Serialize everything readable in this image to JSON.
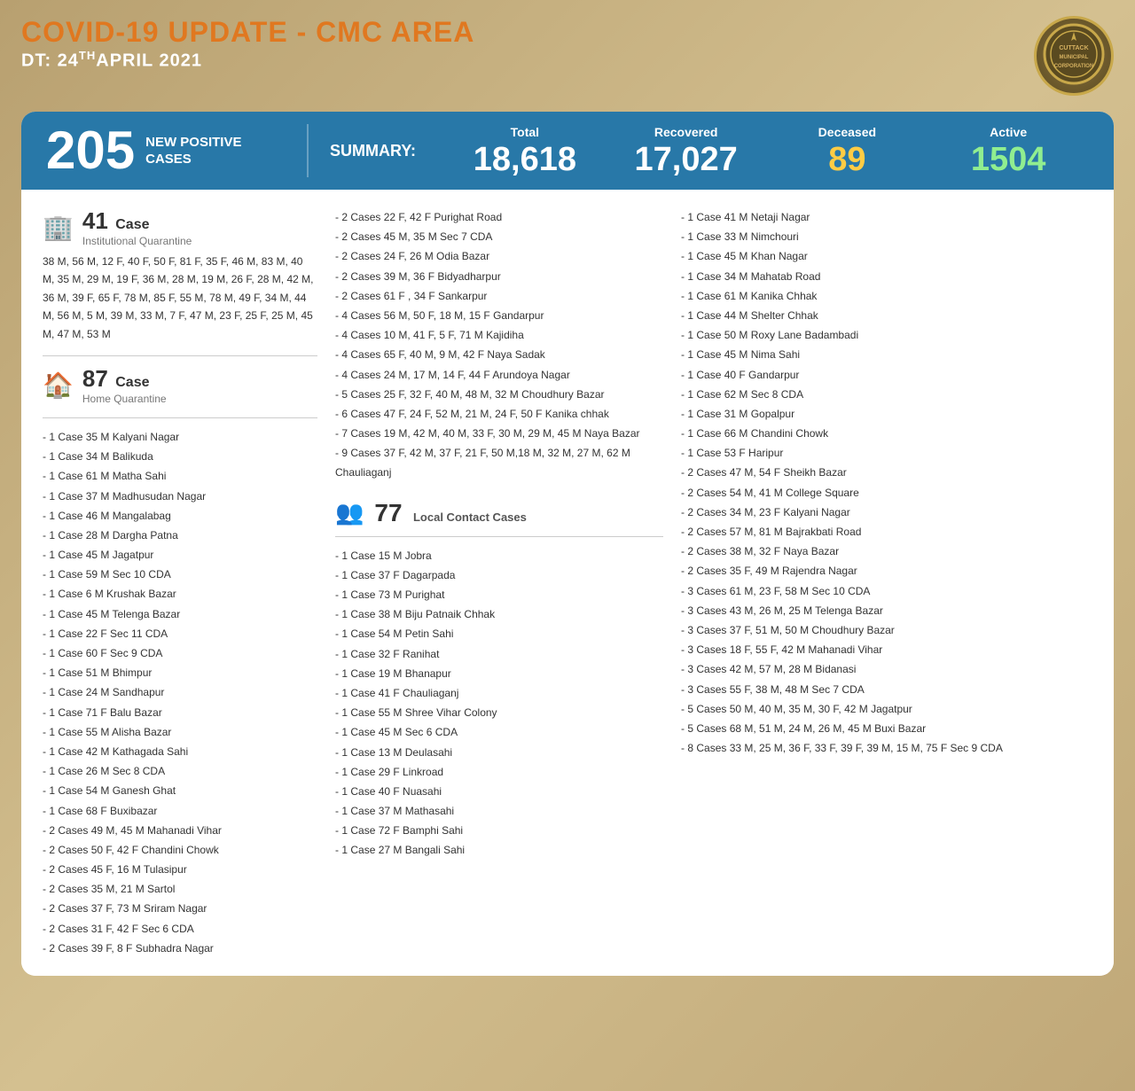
{
  "header": {
    "title": "COVID-19 UPDATE - CMC AREA",
    "date_label": "DT: 24",
    "date_sup": "TH",
    "date_rest": "APRIL 2021"
  },
  "summary": {
    "new_positive": "205",
    "new_positive_label": "NEW POSITIVE\nCASES",
    "summary_label": "SUMMARY:",
    "total_label": "Total",
    "total_value": "18,618",
    "recovered_label": "Recovered",
    "recovered_value": "17,027",
    "deceased_label": "Deceased",
    "deceased_value": "89",
    "active_label": "Active",
    "active_value": "1504"
  },
  "institutional_quarantine": {
    "count": "41",
    "label": "Case",
    "sublabel": "Institutional Quarantine",
    "data": "38 M,  56 M,  12 F,  40 F,  50 F,  81 F,  35 F,  46 M,  83 M,  40 M, 35 M, 29 M, 19 F, 36 M, 28 M, 19 M, 26 F, 28 M, 42 M, 36 M, 39 F, 65 F, 78 M, 85 F, 55 M, 78 M,  49 F,  34 M,  44 M,  56 M,  5 M,  39 M,  33 M,  7 F,  47 M,  23 F,  25 F, 25 M,  45 M,  47 M,  53 M"
  },
  "home_quarantine": {
    "count": "87",
    "label": "Case",
    "sublabel": "Home Quarantine",
    "cases": [
      "1 Case 35 M Kalyani Nagar",
      "1 Case 34 M Balikuda",
      "1 Case 61  M Matha Sahi",
      "1 Case 37  M Madhusudan Nagar",
      "1 Case 46  M Mangalabag",
      "1 Case 28  M Dargha Patna",
      "1 Case 45  M Jagatpur",
      "1 Case 59  M Sec 10 CDA",
      "1 Case 6   M Krushak Bazar",
      "1 Case 45  M Telenga Bazar",
      "1 Case 22  F Sec 11 CDA",
      "1 Case 60 F Sec 9 CDA",
      "1 Case 51 M Bhimpur",
      "1 Case 24 M Sandhapur",
      "1 Case 71 F Balu Bazar",
      "1 Case 55 M Alisha Bazar",
      "1 Case 42 M Kathagada Sahi",
      "1 Case 26 M Sec 8 CDA",
      "1 Case 54 M Ganesh Ghat",
      "1 Case 68 F Buxibazar",
      "2 Cases 49 M, 45 M Mahanadi Vihar",
      "2 Cases 50 F, 42 F Chandini Chowk",
      "2 Cases 45  F, 16 M Tulasipur",
      "2 Cases 35  M, 21 M Sartol",
      "2 Cases 37  F, 73 M Sriram Nagar",
      "2 Cases 31  F, 42 F Sec 6 CDA",
      "2 Cases 39  F, 8 F Subhadra Nagar"
    ]
  },
  "middle_cases": {
    "cases": [
      "2 Cases 22  F, 42 F Purighat Road",
      "2 Cases 45  M, 35 M Sec 7 CDA",
      "2 Cases 24 F, 26 M Odia Bazar",
      "2 Cases 39 M, 36 F  Bidyadharpur",
      "2 Cases 61 F , 34 F  Sankarpur",
      "4 Cases 56 M, 50 F, 18 M, 15 F Gandarpur",
      "4 Cases 10 M, 41 F, 5 F, 71 M Kajidiha",
      "4 Cases 65 F, 40 M, 9 M, 42 F Naya Sadak",
      "4 Cases 24 M, 17 M, 14 F, 44 F Arundoya Nagar",
      "5 Cases 25 F, 32 F, 40 M, 48 M, 32 M Choudhury Bazar",
      "6 Cases  47 F, 24 F, 52 M, 21 M, 24 F, 50 F Kanika chhak",
      "7 Cases 19 M, 42 M, 40 M, 33 F, 30 M, 29 M, 45 M Naya Bazar",
      "9 Cases 37 F, 42 M, 37 F, 21 F, 50 M,18 M, 32 M, 27 M, 62 M Chauliaganj"
    ]
  },
  "local_contact": {
    "count": "77",
    "label": "Local Contact Cases",
    "cases": [
      "1 Case 15 M Jobra",
      "1 Case 37 F Dagarpada",
      "1 Case 73 M Purighat",
      "1 Case 38  M Biju Patnaik Chhak",
      "1 Case 54  M Petin Sahi",
      "1 Case 32  F Ranihat",
      "1 Case 19  M Bhanapur",
      "1 Case 41  F Chauliaganj",
      "1 Case 55  M Shree Vihar Colony",
      "1 Case 45  M Sec 6 CDA",
      "1 Case 13  M Deulasahi",
      "1 Case 29  F Linkroad",
      "1 Case 40 F Nuasahi",
      "1 Case 37 M Mathasahi",
      "1 Case 72 F Bamphi Sahi",
      "1 Case 27 M Bangali Sahi"
    ]
  },
  "right_cases": {
    "cases": [
      "1 Case 41 M Netaji Nagar",
      "1 Case 33 M Nimchouri",
      "1 Case 45 M Khan Nagar",
      "1 Case 34 M Mahatab Road",
      "1 Case 61 M Kanika Chhak",
      "1 Case 44 M Shelter Chhak",
      "1 Case 50 M Roxy Lane Badambadi",
      "1 Case 45 M Nima Sahi",
      "1 Case 40  F Gandarpur",
      "1 Case 62  M Sec 8 CDA",
      "1 Case 31 M Gopalpur",
      "1 Case 66 M Chandini Chowk",
      "1 Case 53 F Haripur",
      "2 Cases 47 M, 54 F Sheikh Bazar",
      "2 Cases 54 M, 41  M College Square",
      "2 Cases 34  M, 23 F Kalyani Nagar",
      "2 Cases 57 M, 81 M Bajrakbati Road",
      "2 Cases 38  M, 32  F Naya Bazar",
      "2 Cases 35 F, 49 M  Rajendra Nagar",
      "3 Cases 61 M, 23 F, 58 M Sec 10 CDA",
      "3 Cases 43 M, 26 M, 25 M Telenga Bazar",
      "3 Cases 37 F, 51 M, 50 M Choudhury Bazar",
      "3 Cases 18  F, 55 F, 42 M Mahanadi Vihar",
      "3 Cases 42 M, 57 M, 28 M Bidanasi",
      "3 Cases 55 F, 38 M, 48 M Sec 7 CDA",
      "5 Cases 50 M, 40 M, 35 M, 30 F, 42 M Jagatpur",
      "5 Cases 68 M, 51 M, 24 M, 26 M, 45 M Buxi Bazar",
      "8 Cases 33 M, 25 M, 36 F, 33 F, 39 F, 39 M, 15 M, 75 F  Sec 9 CDA"
    ]
  }
}
